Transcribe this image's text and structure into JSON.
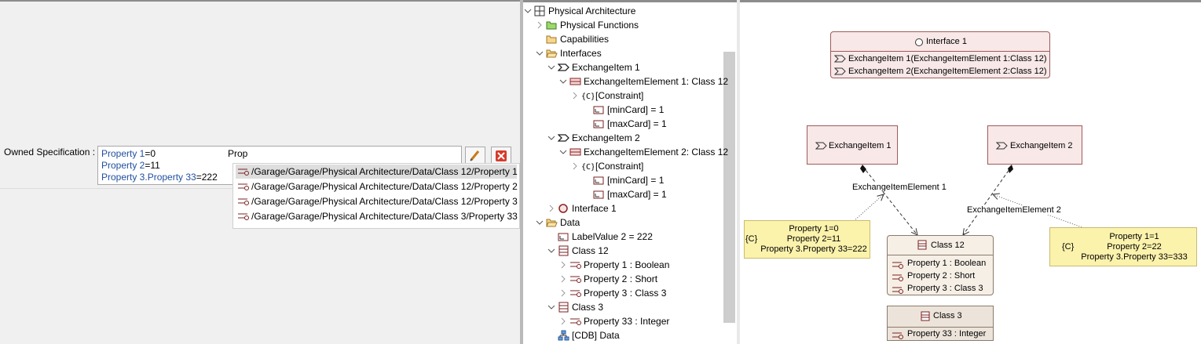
{
  "left": {
    "owned_label": "Owned Specification :",
    "spec_lines": [
      {
        "kw": "Property 1",
        "rest": "=0"
      },
      {
        "kw": "Property 2",
        "rest": "=11"
      },
      {
        "kw": "Property 3.Property 33",
        "rest": "=222"
      }
    ],
    "typed_text": "Prop",
    "autocomplete": [
      "/Garage/Garage/Physical Architecture/Data/Class 12/Property 1",
      "/Garage/Garage/Physical Architecture/Data/Class 12/Property 2",
      "/Garage/Garage/Physical Architecture/Data/Class 12/Property 3",
      "/Garage/Garage/Physical Architecture/Data/Class 3/Property 33"
    ]
  },
  "tree": [
    {
      "label": "Physical Architecture",
      "icon": "grid-icon",
      "expanded": true
    },
    {
      "label": "Physical Functions",
      "icon": "folder-green-icon",
      "expanded": false
    },
    {
      "label": "Capabilities",
      "icon": "folder-icon",
      "expanded": null
    },
    {
      "label": "Interfaces",
      "icon": "folder-open-icon",
      "expanded": true
    },
    {
      "label": "ExchangeItem 1",
      "icon": "exchange-item-icon",
      "expanded": true
    },
    {
      "label": "ExchangeItemElement 1: Class 12",
      "icon": "exchange-element-icon",
      "expanded": true
    },
    {
      "label": "[Constraint]",
      "icon": "constraint-icon",
      "expanded": false
    },
    {
      "label": "[minCard]  = 1",
      "icon": "card-icon",
      "expanded": null
    },
    {
      "label": "[maxCard]  = 1",
      "icon": "card-icon",
      "expanded": null
    },
    {
      "label": "ExchangeItem 2",
      "icon": "exchange-item-icon",
      "expanded": true
    },
    {
      "label": "ExchangeItemElement 2: Class 12",
      "icon": "exchange-element-icon",
      "expanded": true
    },
    {
      "label": "[Constraint]",
      "icon": "constraint-icon",
      "expanded": false
    },
    {
      "label": "[minCard]  = 1",
      "icon": "card-icon",
      "expanded": null
    },
    {
      "label": "[maxCard]  = 1",
      "icon": "card-icon",
      "expanded": null
    },
    {
      "label": "Interface 1",
      "icon": "interface-icon",
      "expanded": false
    },
    {
      "label": "Data",
      "icon": "folder-open-icon",
      "expanded": true
    },
    {
      "label": "LabelValue 2 = 222",
      "icon": "card-icon",
      "expanded": null
    },
    {
      "label": "Class 12",
      "icon": "class-icon",
      "expanded": true
    },
    {
      "label": "Property 1 : Boolean",
      "icon": "property-icon",
      "expanded": false
    },
    {
      "label": "Property 2 : Short",
      "icon": "property-icon",
      "expanded": false
    },
    {
      "label": "Property 3 : Class 3",
      "icon": "property-icon",
      "expanded": false
    },
    {
      "label": "Class 3",
      "icon": "class-icon",
      "expanded": true
    },
    {
      "label": "Property 33 : Integer",
      "icon": "property-icon",
      "expanded": false
    },
    {
      "label": "[CDB] Data",
      "icon": "cdb-icon",
      "expanded": null
    }
  ],
  "diagram": {
    "interface": {
      "title": "Interface 1",
      "items": [
        "ExchangeItem 1(ExchangeItemElement 1:Class 12)",
        "ExchangeItem 2(ExchangeItemElement 2:Class 12)"
      ]
    },
    "exchange_item_1": "ExchangeItem 1",
    "exchange_item_2": "ExchangeItem 2",
    "element_label_1": "ExchangeItemElement 1",
    "element_label_2": "ExchangeItemElement 2",
    "class12": {
      "title": "Class 12",
      "props": [
        "Property 1 : Boolean",
        "Property 2 : Short",
        "Property 3 : Class 3"
      ]
    },
    "class3": {
      "title": "Class 3",
      "props": [
        "Property 33 : Integer"
      ]
    },
    "note1": {
      "tag": "{C}",
      "lines": [
        "Property 1=0",
        "Property 2=11",
        "Property 3.Property 33=222"
      ]
    },
    "note2": {
      "tag": "{C}",
      "lines": [
        "Property 1=1",
        "Property 2=22",
        "Property 3.Property 33=333"
      ]
    }
  }
}
